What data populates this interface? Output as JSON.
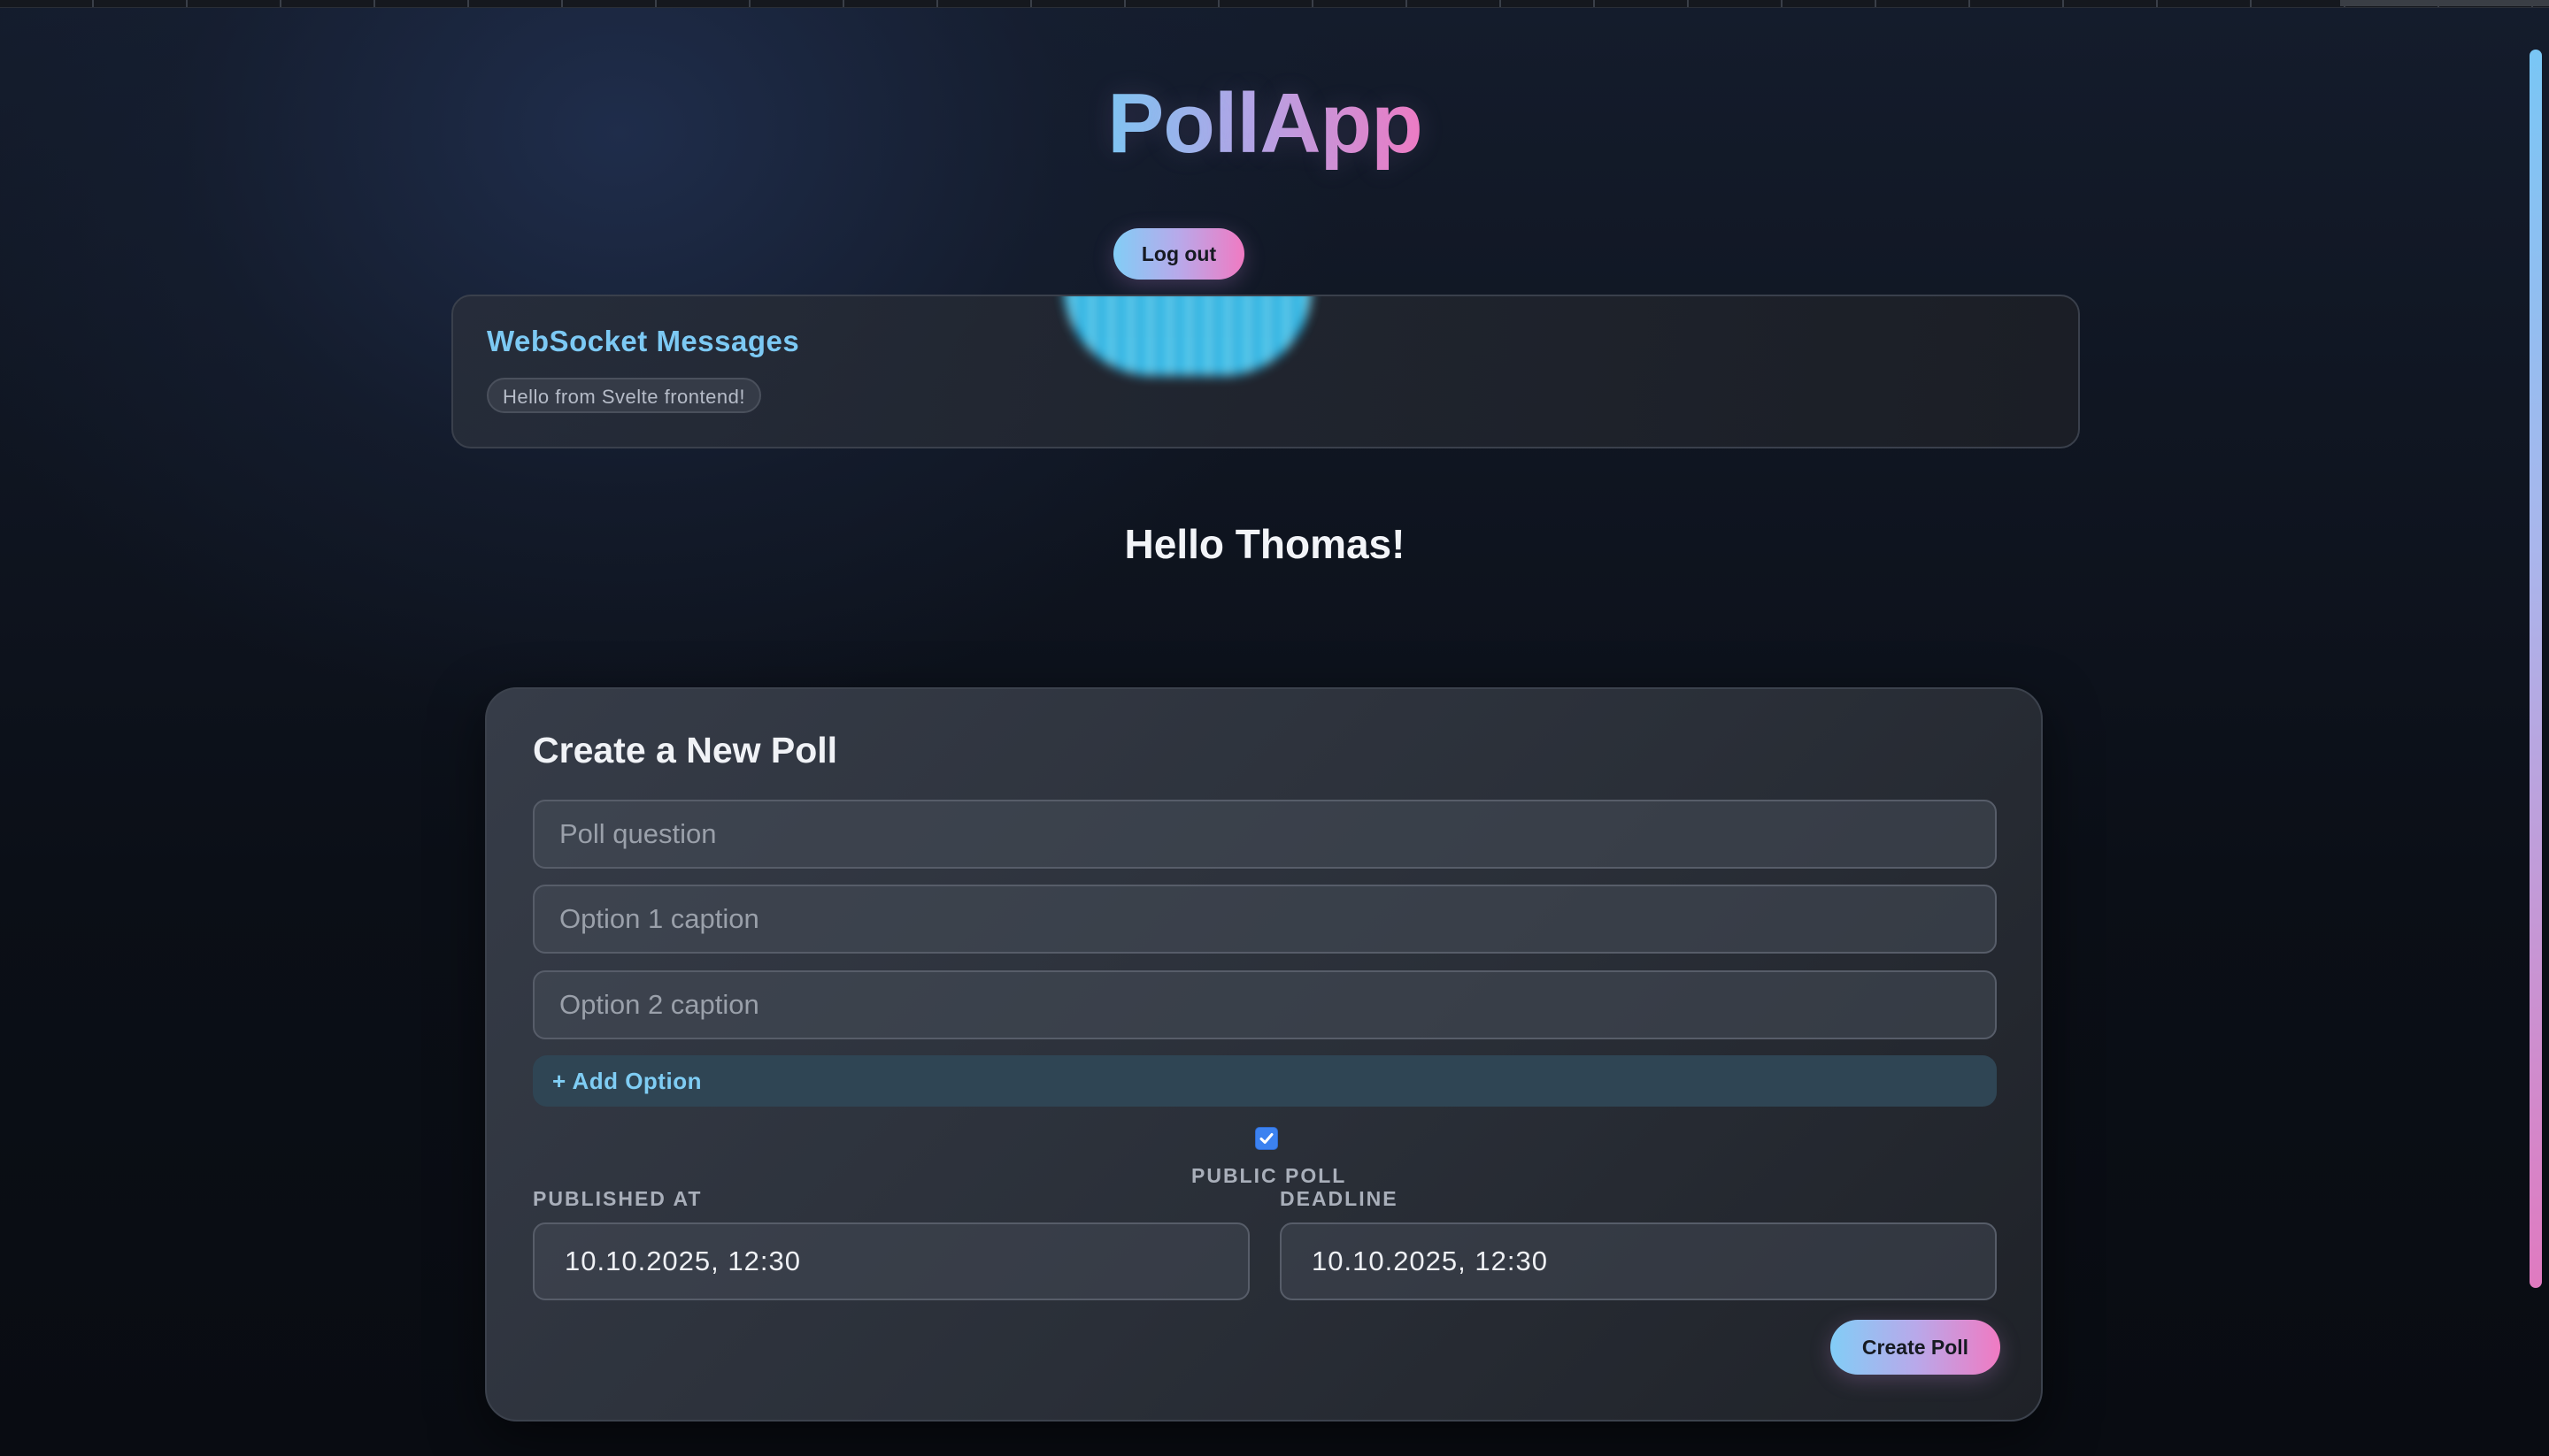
{
  "app": {
    "title": "PollApp"
  },
  "header": {
    "logout_label": "Log out"
  },
  "websocket": {
    "title": "WebSocket Messages",
    "messages": [
      "Hello from Svelte frontend!"
    ]
  },
  "greeting": "Hello Thomas!",
  "poll_form": {
    "title": "Create a New Poll",
    "question_placeholder": "Poll question",
    "option1_placeholder": "Option 1 caption",
    "option2_placeholder": "Option 2 caption",
    "add_option_label": "+ Add Option",
    "public_label": "PUBLIC POLL",
    "public_checked": true,
    "published_label": "PUBLISHED AT",
    "published_value": "10.10.2025, 12:30",
    "deadline_label": "DEADLINE",
    "deadline_value": "10.10.2025, 12:30",
    "create_label": "Create Poll"
  },
  "colors": {
    "accent_blue": "#7cc9f4",
    "accent_pink": "#f07ac2",
    "checkbox": "#3c82f0"
  }
}
